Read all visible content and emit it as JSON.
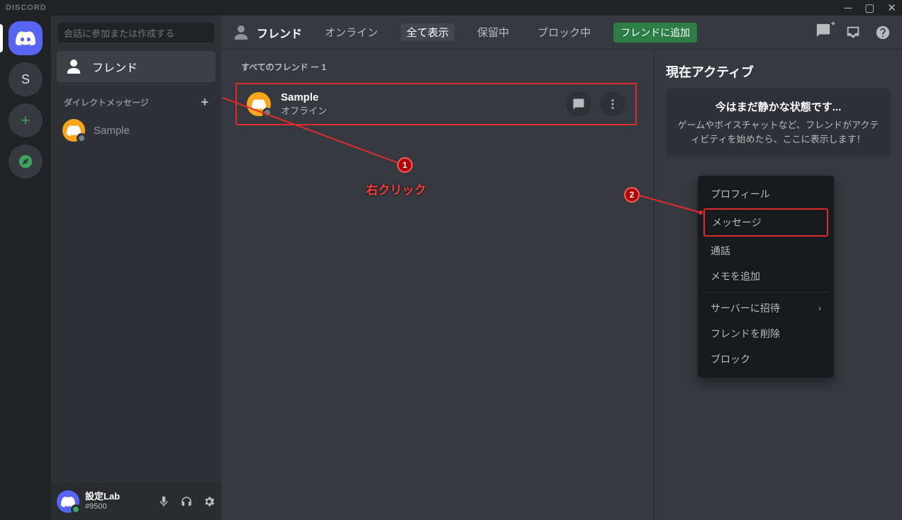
{
  "window": {
    "brand": "DISCORD"
  },
  "servers": {
    "letter": "S"
  },
  "sidebar": {
    "search_placeholder": "会話に参加または作成する",
    "friends_label": "フレンド",
    "dm_header": "ダイレクトメッセージ",
    "dm_items": [
      {
        "name": "Sample"
      }
    ]
  },
  "user": {
    "name": "設定Lab",
    "tag": "#9500"
  },
  "header": {
    "title": "フレンド",
    "tabs": {
      "online": "オンライン",
      "all": "全て表示",
      "pending": "保留中",
      "blocked": "ブロック中"
    },
    "add_friend": "フレンドに追加"
  },
  "list": {
    "heading": "すべてのフレンド ー 1",
    "rows": [
      {
        "name": "Sample",
        "status": "オフライン"
      }
    ]
  },
  "context_menu": {
    "profile": "プロフィール",
    "message": "メッセージ",
    "call": "通話",
    "add_note": "メモを追加",
    "invite": "サーバーに招待",
    "remove": "フレンドを削除",
    "block": "ブロック"
  },
  "now_playing": {
    "title": "現在アクティブ",
    "card_heading": "今はまだ静かな状態です...",
    "card_body": "ゲームやボイスチャットなど、フレンドがアクティビティを始めたら、ここに表示します！"
  },
  "annotations": {
    "badge1": "1",
    "badge2": "2",
    "right_click": "右クリック"
  }
}
